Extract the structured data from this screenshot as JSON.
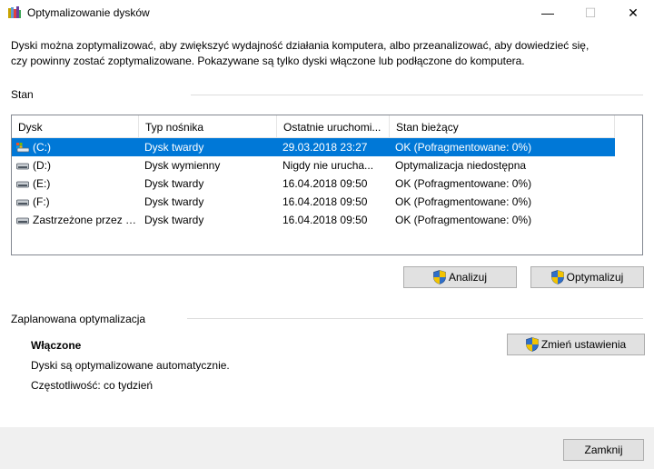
{
  "window": {
    "title": "Optymalizowanie dysków",
    "minimize": "—",
    "maximize": "☐",
    "close": "✕"
  },
  "intro": {
    "line1": "Dyski można zoptymalizować, aby zwiększyć wydajność działania komputera, albo przeanalizować, aby dowiedzieć się,",
    "line2": "czy powinny zostać zoptymalizowane. Pokazywane są tylko dyski włączone lub podłączone do komputera."
  },
  "status_group": {
    "label": "Stan"
  },
  "table": {
    "columns": [
      "Dysk",
      "Typ nośnika",
      "Ostatnie uruchomi...",
      "Stan bieżący"
    ],
    "rows": [
      {
        "drive": "(C:)",
        "type": "Dysk twardy",
        "last_run": "29.03.2018 23:27",
        "state": "OK (Pofragmentowane: 0%)",
        "icon": "system-drive-icon",
        "selected": true
      },
      {
        "drive": "(D:)",
        "type": "Dysk wymienny",
        "last_run": "Nigdy nie urucha...",
        "state": "Optymalizacja niedostępna",
        "icon": "removable-drive-icon",
        "selected": false
      },
      {
        "drive": "(E:)",
        "type": "Dysk twardy",
        "last_run": "16.04.2018 09:50",
        "state": "OK (Pofragmentowane: 0%)",
        "icon": "hard-drive-icon",
        "selected": false
      },
      {
        "drive": "(F:)",
        "type": "Dysk twardy",
        "last_run": "16.04.2018 09:50",
        "state": "OK (Pofragmentowane: 0%)",
        "icon": "hard-drive-icon",
        "selected": false
      },
      {
        "drive": "Zastrzeżone przez s...",
        "type": "Dysk twardy",
        "last_run": "16.04.2018 09:50",
        "state": "OK (Pofragmentowane: 0%)",
        "icon": "hard-drive-icon",
        "selected": false
      }
    ]
  },
  "buttons": {
    "analyze": "Analizuj",
    "optimize": "Optymalizuj",
    "change_settings": "Zmień ustawienia",
    "close": "Zamknij"
  },
  "schedule": {
    "label": "Zaplanowana optymalizacja",
    "status": "Włączone",
    "description": "Dyski są optymalizowane automatycznie.",
    "frequency": "Częstotliwość: co tydzień"
  },
  "colors": {
    "selection": "#0078d7",
    "button_face": "#e1e1e1",
    "footer": "#f0f0f0"
  }
}
